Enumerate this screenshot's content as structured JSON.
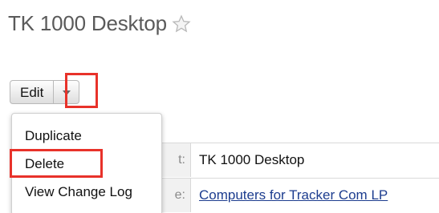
{
  "record": {
    "title": "TK 1000 Desktop",
    "favorite_icon": "star-icon"
  },
  "actions": {
    "edit_label": "Edit",
    "caret_icon": "chevron-down-icon"
  },
  "menu": {
    "items": [
      {
        "label": "Duplicate"
      },
      {
        "label": "Delete"
      },
      {
        "label": "View Change Log"
      }
    ]
  },
  "details": {
    "rows": [
      {
        "label_fragment": "t:",
        "value": "TK 1000 Desktop"
      },
      {
        "label_fragment": "e:",
        "value": "Computers for Tracker Com LP"
      }
    ]
  },
  "colors": {
    "highlight": "#e8322a",
    "link": "#1d3d8f"
  }
}
